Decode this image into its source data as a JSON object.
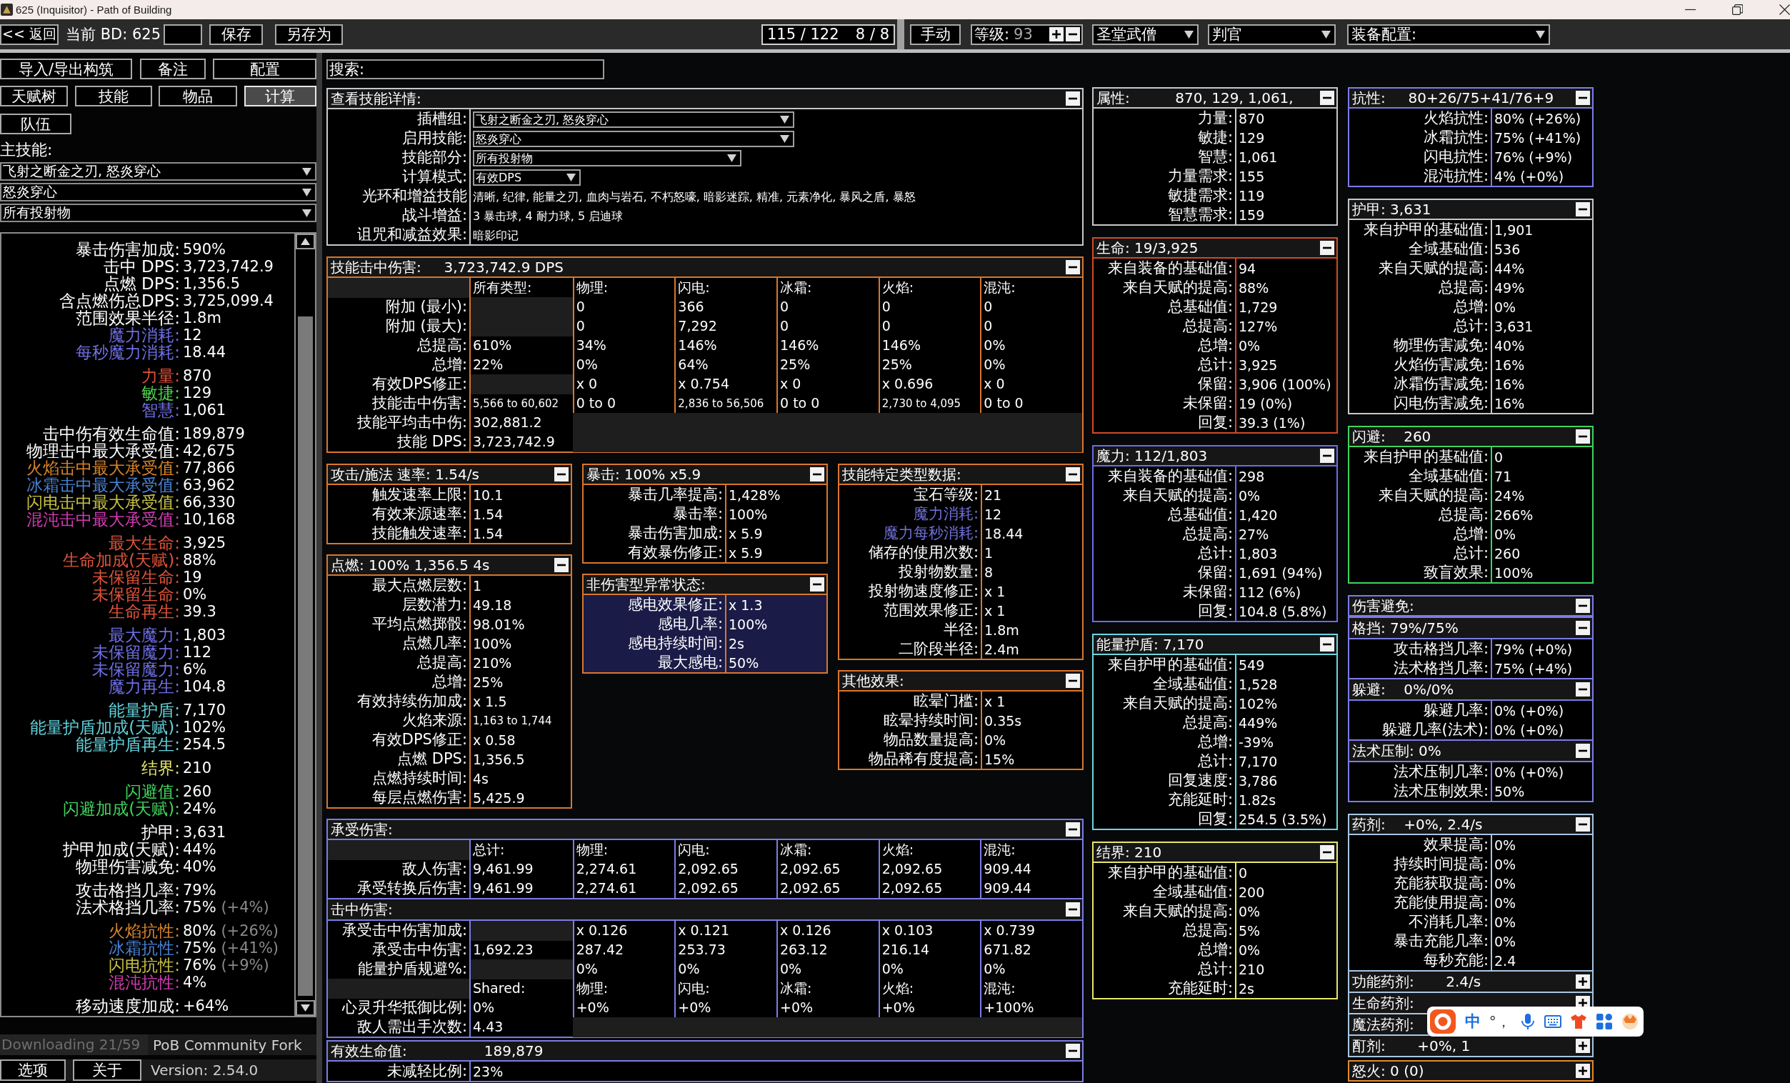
{
  "window": {
    "title": "625 (Inquisitor) - Path of Building"
  },
  "toolbar": {
    "back": "<< 返回",
    "build": "当前 BD: 625",
    "save": "保存",
    "save_as": "另存为",
    "points": "115 / 122",
    "ascendancy_points": "8 / 8",
    "mode": "手动",
    "level_label": "等级:",
    "level": "93",
    "class": "圣堂武僧",
    "ascendancy": "判官",
    "gear_set": "装备配置:"
  },
  "left_panel": {
    "buttons": [
      "导入/导出构筑",
      "备注",
      "配置"
    ],
    "tabs": [
      {
        "label": "天赋树",
        "selected": false
      },
      {
        "label": "技能",
        "selected": false
      },
      {
        "label": "物品",
        "selected": false
      },
      {
        "label": "计算",
        "selected": true
      }
    ],
    "party": "队伍",
    "main_skill_label": "主技能:",
    "skill_selects": [
      "飞射之断金之刃, 怒炎穿心",
      "怒炎穿心",
      "所有投射物"
    ],
    "stat_groups": [
      [
        {
          "label": "暴击伤害加成:",
          "value": "590%",
          "color": "#ffffff"
        },
        {
          "label": "击中 DPS:",
          "value": "3,723,742.9",
          "color": "#ffffff"
        },
        {
          "label": "点燃 DPS:",
          "value": "1,356.5",
          "color": "#ffffff"
        },
        {
          "label": "含点燃伤总DPS:",
          "value": "3,725,099.4",
          "color": "#ffffff"
        },
        {
          "label": "范围效果半径:",
          "value": "1.8m",
          "color": "#ffffff"
        },
        {
          "label": "魔力消耗:",
          "value": "12",
          "color": "#6f6fe6"
        },
        {
          "label": "每秒魔力消耗:",
          "value": "18.44",
          "color": "#6f6fe6"
        }
      ],
      [
        {
          "label": "力量:",
          "value": "870",
          "color": "#e0533a"
        },
        {
          "label": "敏捷:",
          "value": "129",
          "color": "#4fd64f"
        },
        {
          "label": "智慧:",
          "value": "1,061",
          "color": "#6f6fe6"
        }
      ],
      [
        {
          "label": "击中伤有效生命值:",
          "value": "189,879",
          "color": "#ffffff"
        },
        {
          "label": "物理击中最大承受值:",
          "value": "42,675",
          "color": "#ffffff"
        },
        {
          "label": "火焰击中最大承受值:",
          "value": "77,866",
          "color": "#d8842c"
        },
        {
          "label": "冰霜击中最大承受值:",
          "value": "63,962",
          "color": "#4a82d6"
        },
        {
          "label": "闪电击中最大承受值:",
          "value": "66,330",
          "color": "#c8c244"
        },
        {
          "label": "混沌击中最大承受值:",
          "value": "10,168",
          "color": "#d23cb2"
        }
      ],
      [
        {
          "label": "最大生命:",
          "value": "3,925",
          "color": "#e0533a"
        },
        {
          "label": "生命加成(天赋):",
          "value": "88%",
          "color": "#e0533a"
        },
        {
          "label": "未保留生命:",
          "value": "19",
          "color": "#e0533a"
        },
        {
          "label": "未保留生命:",
          "value": "0%",
          "color": "#e0533a"
        },
        {
          "label": "生命再生:",
          "value": "39.3",
          "color": "#e0533a"
        }
      ],
      [
        {
          "label": "最大魔力:",
          "value": "1,803",
          "color": "#6f6fe6"
        },
        {
          "label": "未保留魔力:",
          "value": "112",
          "color": "#6f6fe6"
        },
        {
          "label": "未保留魔力:",
          "value": "6%",
          "color": "#6f6fe6"
        },
        {
          "label": "魔力再生:",
          "value": "104.8",
          "color": "#6f6fe6"
        }
      ],
      [
        {
          "label": "能量护盾:",
          "value": "7,170",
          "color": "#62d2dc"
        },
        {
          "label": "能量护盾加成(天赋):",
          "value": "102%",
          "color": "#62d2dc"
        },
        {
          "label": "能量护盾再生:",
          "value": "254.5",
          "color": "#62d2dc"
        }
      ],
      [
        {
          "label": "结界:",
          "value": "210",
          "color": "#e4e46c"
        }
      ],
      [
        {
          "label": "闪避值:",
          "value": "260",
          "color": "#40d45c"
        },
        {
          "label": "闪避加成(天赋):",
          "value": "24%",
          "color": "#40d45c"
        }
      ],
      [
        {
          "label": "护甲:",
          "value": "3,631",
          "color": "#ffffff"
        },
        {
          "label": "护甲加成(天赋):",
          "value": "44%",
          "color": "#ffffff"
        },
        {
          "label": "物理伤害减免:",
          "value": "40%",
          "color": "#ffffff"
        }
      ],
      [
        {
          "label": "攻击格挡几率:",
          "value": "79%",
          "color": "#ffffff"
        },
        {
          "label": "法术格挡几率:",
          "value": "75%",
          "note": "(+4%)",
          "color": "#ffffff"
        }
      ],
      [
        {
          "label": "火焰抗性:",
          "value": "80%",
          "note": "(+26%)",
          "color": "#d8842c"
        },
        {
          "label": "冰霜抗性:",
          "value": "75%",
          "note": "(+41%)",
          "color": "#4a82d6"
        },
        {
          "label": "闪电抗性:",
          "value": "76%",
          "note": "(+9%)",
          "color": "#c8c244"
        },
        {
          "label": "混沌抗性:",
          "value": "4%",
          "color": "#d23cb2"
        }
      ],
      [
        {
          "label": "移动速度加成:",
          "value": "+64%",
          "color": "#ffffff"
        }
      ]
    ],
    "status": "Downloading 21/59",
    "fork": "PoB Community Fork",
    "footer_buttons": [
      "选项",
      "关于"
    ],
    "version": "Version: 2.54.0"
  },
  "middle": {
    "search": {
      "placeholder": "搜索:"
    },
    "details": {
      "title": "查看技能详情:",
      "color": "#c8c8c8",
      "expanded": true,
      "kind": "details",
      "rows": [
        {
          "label": "插槽组:",
          "kind": "select",
          "value": "飞射之断金之刃, 怒炎穿心"
        },
        {
          "label": "启用技能:",
          "kind": "select",
          "value": "怒炎穿心"
        },
        {
          "label": "技能部分:",
          "kind": "select",
          "value": "所有投射物"
        },
        {
          "label": "计算模式:",
          "kind": "select",
          "value": "有效DPS"
        },
        {
          "label": "光环和增益技能",
          "kind": "text",
          "value": "清晰, 纪律, 能量之刃, 血肉与岩石, 不朽怒嚎, 暗影迷踪, 精准, 元素净化, 暴风之盾, 暴怒"
        },
        {
          "label": "战斗增益:",
          "kind": "text",
          "value": "3 暴击球, 4 耐力球, 5 启迪球"
        },
        {
          "label": "诅咒和减益效果:",
          "kind": "text",
          "value": "暗影印记"
        }
      ]
    },
    "skill_damage": {
      "title": "技能击中伤害:     3,723,742.9 DPS",
      "color": "#d8762e",
      "expanded": true,
      "kind": "table",
      "rows": [
        {
          "cells": [
            "所有类型:",
            "物理:",
            "闪电:",
            "冰霜:",
            "火焰:",
            "混沌:"
          ]
        },
        {
          "label": "附加 (最小):",
          "cells": [
            null,
            "0",
            "366",
            "0",
            "0",
            "0"
          ]
        },
        {
          "label": "附加 (最大):",
          "cells": [
            null,
            "0",
            "7,292",
            "0",
            "0",
            "0"
          ]
        },
        {
          "label": "总提高:",
          "cells": [
            "610%",
            "34%",
            "146%",
            "146%",
            "146%",
            "0%"
          ]
        },
        {
          "label": "总增:",
          "cells": [
            "22%",
            "0%",
            "64%",
            "25%",
            "25%",
            "0%"
          ]
        },
        {
          "label": "有效DPS修正:",
          "cells": [
            null,
            "x 0",
            "x 0.754",
            "x 0",
            "x 0.696",
            "x 0"
          ]
        },
        {
          "label": "技能击中伤害:",
          "cells": [
            "5,566 to 60,602",
            "0 to 0",
            "2,836 to 56,506",
            "0 to 0",
            "2,730 to 4,095",
            "0 to 0"
          ]
        },
        {
          "label": "技能平均击中伤:",
          "cells": [
            "302,881.2"
          ]
        },
        {
          "label": "技能 DPS:",
          "cells": [
            "3,723,742.9"
          ]
        }
      ]
    },
    "columns": [
      [
        {
          "title": "攻击/施法 速率: 1.54/s",
          "color": "#d8762e",
          "expanded": true,
          "highlighted": false,
          "kind": "list",
          "rows": [
            {
              "label": "触发速率上限:",
              "value": "10.1"
            },
            {
              "label": "有效来源速率:",
              "value": "1.54"
            },
            {
              "label": "技能触发速率:",
              "value": "1.54"
            }
          ]
        },
        {
          "title": "点燃: 100% 1,356.5 4s",
          "color": "#d8762e",
          "expanded": true,
          "highlighted": false,
          "kind": "list",
          "rows": [
            {
              "label": "最大点燃层数:",
              "value": "1"
            },
            {
              "label": "层数潜力:",
              "value": "49.18"
            },
            {
              "label": "平均点燃掷骰:",
              "value": "98.01%"
            },
            {
              "label": "点燃几率:",
              "value": "100%"
            },
            {
              "label": "总提高:",
              "value": "210%"
            },
            {
              "label": "总增:",
              "value": "25%"
            },
            {
              "label": "有效持续伤加成:",
              "value": "x 1.5"
            },
            {
              "label": "火焰来源:",
              "value": "1,163 to 1,744"
            },
            {
              "label": "有效DPS修正:",
              "value": "x 0.58"
            },
            {
              "label": "点燃 DPS:",
              "value": "1,356.5"
            },
            {
              "label": "点燃持续时间:",
              "value": "4s"
            },
            {
              "label": "每层点燃伤害:",
              "value": "5,425.9"
            }
          ]
        }
      ],
      [
        {
          "title": "暴击: 100% x5.9",
          "color": "#d8762e",
          "expanded": true,
          "highlighted": false,
          "kind": "list",
          "rows": [
            {
              "label": "暴击几率提高:",
              "value": "1,428%"
            },
            {
              "label": "暴击率:",
              "value": "100%"
            },
            {
              "label": "暴击伤害加成:",
              "value": "x 5.9"
            },
            {
              "label": "有效暴伤修正:",
              "value": "x 5.9"
            }
          ]
        },
        {
          "title": "非伤害型异常状态:",
          "color": "#d8762e",
          "expanded": true,
          "highlighted": true,
          "kind": "list",
          "rows": [
            {
              "label": "感电效果修正:",
              "value": "x 1.3"
            },
            {
              "label": "感电几率:",
              "value": "100%"
            },
            {
              "label": "感电持续时间:",
              "value": "2s"
            },
            {
              "label": "最大感电:",
              "value": "50%"
            }
          ]
        }
      ],
      [
        {
          "title": "技能特定类型数据:",
          "color": "#d8762e",
          "expanded": true,
          "highlighted": false,
          "kind": "list",
          "rows": [
            {
              "label": "宝石等级:",
              "value": "21",
              "color": "#ffffff"
            },
            {
              "label": "魔力消耗:",
              "value": "12",
              "color": "#7070dc"
            },
            {
              "label": "魔力每秒消耗:",
              "value": "18.44",
              "color": "#7070dc"
            },
            {
              "label": "储存的使用次数:",
              "value": "1",
              "color": "#ffffff"
            },
            {
              "label": "投射物数量:",
              "value": "8",
              "color": "#ffffff"
            },
            {
              "label": "投射物速度修正:",
              "value": "x 1",
              "color": "#ffffff"
            },
            {
              "label": "范围效果修正:",
              "value": "x 1",
              "color": "#ffffff"
            },
            {
              "label": "半径:",
              "value": "1.8m",
              "color": "#ffffff"
            },
            {
              "label": "二阶段半径:",
              "value": "2.4m",
              "color": "#ffffff"
            }
          ]
        },
        {
          "title": "其他效果:",
          "color": "#d8762e",
          "expanded": true,
          "highlighted": false,
          "kind": "list",
          "rows": [
            {
              "label": "眩晕门槛:",
              "value": "x 1"
            },
            {
              "label": "眩晕持续时间:",
              "value": "0.35s"
            },
            {
              "label": "物品数量提高:",
              "value": "0%"
            },
            {
              "label": "物品稀有度提高:",
              "value": "15%"
            }
          ]
        }
      ]
    ],
    "lower": [
      {
        "title": "承受伤害:",
        "color": "#7c7ce6",
        "expanded": true,
        "kind": "table",
        "rows": [
          {
            "cells": [
              "总计:",
              "物理:",
              "闪电:",
              "冰霜:",
              "火焰:",
              "混沌:"
            ]
          },
          {
            "label": "敌人伤害:",
            "cells": [
              "9,461.99",
              "2,274.61",
              "2,092.65",
              "2,092.65",
              "2,092.65",
              "909.44"
            ]
          },
          {
            "label": "承受转换后伤害:",
            "cells": [
              "9,461.99",
              "2,274.61",
              "2,092.65",
              "2,092.65",
              "2,092.65",
              "909.44"
            ]
          }
        ],
        "subsections": [
          {
            "title": "击中伤害:",
            "expanded": true,
            "kind": "table",
            "rows": [
              {
                "label": "承受击中伤害加成:",
                "cells": [
                  null,
                  "x 0.126",
                  "x 0.121",
                  "x 0.126",
                  "x 0.103",
                  "x 0.739"
                ]
              },
              {
                "label": "承受击中伤害:",
                "cells": [
                  "1,692.23",
                  "287.42",
                  "253.73",
                  "263.12",
                  "216.14",
                  "671.82"
                ]
              },
              {
                "label": "能量护盾规避%:",
                "cells": [
                  null,
                  "0%",
                  "0%",
                  "0%",
                  "0%",
                  "0%"
                ]
              },
              {
                "cells": [
                  "Shared:",
                  "物理:",
                  "闪电:",
                  "冰霜:",
                  "火焰:",
                  "混沌:"
                ]
              },
              {
                "label": "心灵升华抵御比例:",
                "cells": [
                  "0%",
                  "+0%",
                  "+0%",
                  "+0%",
                  "+0%",
                  "+100%"
                ]
              },
              {
                "label": "敌人需出手次数:",
                "cells": [
                  "4.43"
                ]
              }
            ]
          }
        ]
      },
      {
        "title": "有效生命值:                 189,879",
        "color": "#7c7ce6",
        "expanded": true,
        "kind": "list",
        "rows": [
          {
            "label": "未减轻比例:",
            "value": "23%"
          }
        ]
      }
    ]
  },
  "right_columns": [
    [
      {
        "title": "属性:          870, 129, 1,061,",
        "color": "#c8c8c8",
        "expanded": true,
        "kind": "list",
        "rows": [
          {
            "label": "力量:",
            "value": "870"
          },
          {
            "label": "敏捷:",
            "value": "129"
          },
          {
            "label": "智慧:",
            "value": "1,061"
          },
          {
            "label": "力量需求:",
            "value": "155"
          },
          {
            "label": "敏捷需求:",
            "value": "119"
          },
          {
            "label": "智慧需求:",
            "value": "159"
          }
        ]
      },
      {
        "title": "生命: 19/3,925",
        "color": "#d24a26",
        "expanded": true,
        "kind": "list",
        "rows": [
          {
            "label": "来自装备的基础值:",
            "value": "94"
          },
          {
            "label": "来自天赋的提高:",
            "value": "88%"
          },
          {
            "label": "总基础值:",
            "value": "1,729"
          },
          {
            "label": "总提高:",
            "value": "127%"
          },
          {
            "label": "总增:",
            "value": "0%"
          },
          {
            "label": "总计:",
            "value": "3,925"
          },
          {
            "label": "保留:",
            "value": "3,906 (100%)"
          },
          {
            "label": "未保留:",
            "value": "19 (0%)"
          },
          {
            "label": "回复:",
            "value": "39.3 (1%)"
          }
        ]
      },
      {
        "title": "魔力: 112/1,803",
        "color": "#6c6ce4",
        "expanded": true,
        "kind": "list",
        "rows": [
          {
            "label": "来自装备的基础值:",
            "value": "298"
          },
          {
            "label": "来自天赋的提高:",
            "value": "0%"
          },
          {
            "label": "总基础值:",
            "value": "1,420"
          },
          {
            "label": "总提高:",
            "value": "27%"
          },
          {
            "label": "总计:",
            "value": "1,803"
          },
          {
            "label": "保留:",
            "value": "1,691 (94%)"
          },
          {
            "label": "未保留:",
            "value": "112 (6%)"
          },
          {
            "label": "回复:",
            "value": "104.8 (5.8%)"
          }
        ]
      },
      {
        "title": "能量护盾: 7,170",
        "color": "#6cd6df",
        "expanded": true,
        "kind": "list",
        "rows": [
          {
            "label": "来自护甲的基础值:",
            "value": "549"
          },
          {
            "label": "全域基础值:",
            "value": "1,528"
          },
          {
            "label": "来自天赋的提高:",
            "value": "102%"
          },
          {
            "label": "总提高:",
            "value": "449%"
          },
          {
            "label": "总增:",
            "value": "-39%"
          },
          {
            "label": "总计:",
            "value": "7,170"
          },
          {
            "label": "回复速度:",
            "value": "3,786"
          },
          {
            "label": "充能延时:",
            "value": "1.82s"
          },
          {
            "label": "回复:",
            "value": "254.5 (3.5%)"
          }
        ]
      },
      {
        "title": "结界: 210",
        "color": "#e6e66a",
        "expanded": true,
        "kind": "list",
        "rows": [
          {
            "label": "来自护甲的基础值:",
            "value": "0"
          },
          {
            "label": "全域基础值:",
            "value": "200"
          },
          {
            "label": "来自天赋的提高:",
            "value": "0%"
          },
          {
            "label": "总提高:",
            "value": "5%"
          },
          {
            "label": "总增:",
            "value": "0%"
          },
          {
            "label": "总计:",
            "value": "210"
          },
          {
            "label": "充能延时:",
            "value": "2s"
          }
        ]
      }
    ],
    [
      {
        "title": "抗性:     80+26/75+41/76+9",
        "color": "#7c7ce6",
        "expanded": true,
        "kind": "list",
        "rows": [
          {
            "label": "火焰抗性:",
            "value": "80% (+26%)"
          },
          {
            "label": "冰霜抗性:",
            "value": "75% (+41%)"
          },
          {
            "label": "闪电抗性:",
            "value": "76% (+9%)"
          },
          {
            "label": "混沌抗性:",
            "value": "4% (+0%)"
          }
        ]
      },
      {
        "title": "护甲: 3,631",
        "color": "#c8c8c8",
        "expanded": true,
        "kind": "list",
        "rows": [
          {
            "label": "来自护甲的基础值:",
            "value": "1,901"
          },
          {
            "label": "全域基础值:",
            "value": "536"
          },
          {
            "label": "来自天赋的提高:",
            "value": "44%"
          },
          {
            "label": "总提高:",
            "value": "49%"
          },
          {
            "label": "总增:",
            "value": "0%"
          },
          {
            "label": "总计:",
            "value": "3,631"
          },
          {
            "label": "物理伤害减免:",
            "value": "40%"
          },
          {
            "label": "火焰伤害减免:",
            "value": "16%"
          },
          {
            "label": "冰霜伤害减免:",
            "value": "16%"
          },
          {
            "label": "闪电伤害减免:",
            "value": "16%"
          }
        ]
      },
      {
        "title": "闪避:    260",
        "color": "#3fd45e",
        "expanded": true,
        "kind": "list",
        "rows": [
          {
            "label": "来自护甲的基础值:",
            "value": "0"
          },
          {
            "label": "全域基础值:",
            "value": "71"
          },
          {
            "label": "来自天赋的提高:",
            "value": "24%"
          },
          {
            "label": "总提高:",
            "value": "266%"
          },
          {
            "label": "总增:",
            "value": "0%"
          },
          {
            "label": "总计:",
            "value": "260"
          },
          {
            "label": "致盲效果:",
            "value": "100%"
          }
        ]
      },
      {
        "title": "伤害避免:",
        "color": "#7c7ce6",
        "expanded": true,
        "kind": "group",
        "subsections": [
          {
            "title": "格挡: 79%/75%",
            "expanded": true,
            "kind": "list",
            "rows": [
              {
                "label": "攻击格挡几率:",
                "value": "79% (+0%)"
              },
              {
                "label": "法术格挡几率:",
                "value": "75% (+4%)"
              }
            ]
          },
          {
            "title": "躲避:    0%/0%",
            "expanded": true,
            "kind": "list",
            "rows": [
              {
                "label": "躲避几率:",
                "value": "0% (+0%)"
              },
              {
                "label": "躲避几率(法术):",
                "value": "0% (+0%)"
              }
            ]
          },
          {
            "title": "法术压制: 0%",
            "expanded": true,
            "kind": "list",
            "rows": [
              {
                "label": "法术压制几率:",
                "value": "0% (+0%)"
              },
              {
                "label": "法术压制效果:",
                "value": "50%"
              }
            ]
          }
        ]
      },
      {
        "title": "药剂:    +0%, 2.4/s",
        "color": "#a8c6e4",
        "expanded": true,
        "kind": "list",
        "rows": [
          {
            "label": "效果提高:",
            "value": "0%"
          },
          {
            "label": "持续时间提高:",
            "value": "0%"
          },
          {
            "label": "充能获取提高:",
            "value": "0%"
          },
          {
            "label": "充能使用提高:",
            "value": "0%"
          },
          {
            "label": "不消耗几率:",
            "value": "0%"
          },
          {
            "label": "暴击充能几率:",
            "value": "0%"
          },
          {
            "label": "每秒充能:",
            "value": "2.4"
          }
        ],
        "subsections": [
          {
            "title": "功能药剂:       2.4/s",
            "expanded": false
          },
          {
            "title": "生命药剂:",
            "expanded": false
          },
          {
            "title": "魔法药剂:",
            "expanded": false
          },
          {
            "title": "酊剂:       +0%, 1",
            "expanded": false
          }
        ]
      },
      {
        "title": "怒火: 0 (0)",
        "color": "#e08a2e",
        "expanded": false
      }
    ]
  ],
  "ime_toolbar": {
    "language": "中",
    "punctuation": "°，"
  }
}
